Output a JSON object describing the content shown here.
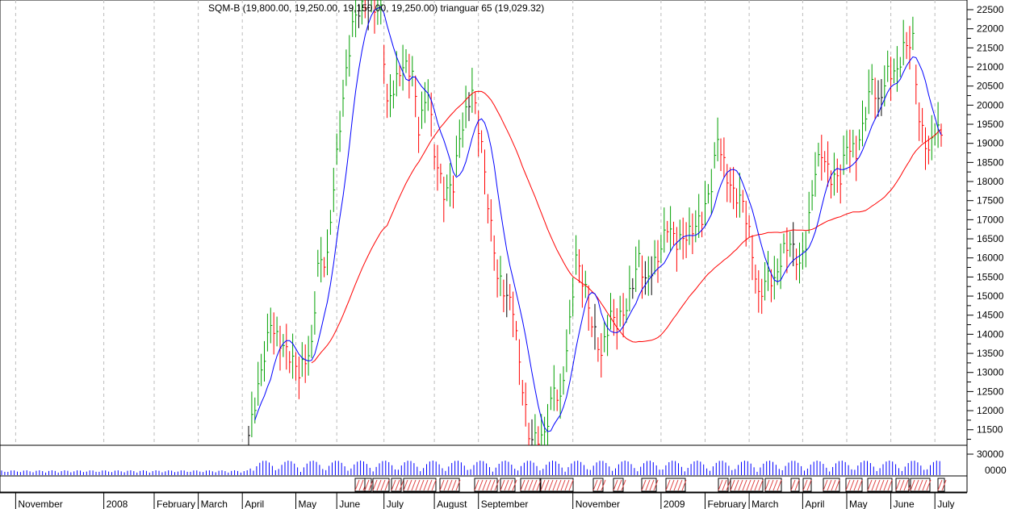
{
  "title": "SQM-B (19,800.00, 19,250.00, 19,150.00, 19,250.00) trianguar 65 (19,029.32)",
  "colors": {
    "up": "#00a000",
    "down": "#ff0000",
    "neutral": "#000000",
    "fast_ma": "#0000ff",
    "slow_ma": "#ff0000",
    "volume": "#0000ff"
  },
  "chart_data": {
    "type": "ohlc",
    "title": "SQM-B",
    "x_unit": "trading day index",
    "ylim": [
      11100,
      22700
    ],
    "y_ticks": [
      11500,
      12000,
      12500,
      13000,
      13500,
      14000,
      14500,
      15000,
      15500,
      16000,
      16500,
      17000,
      17500,
      18000,
      18500,
      19000,
      19500,
      20000,
      20500,
      21000,
      21500,
      22000,
      22500
    ],
    "volume_ticks": [
      "30000",
      "0000"
    ],
    "months": [
      {
        "label": "November",
        "day": -74
      },
      {
        "label": "2008",
        "day": -46
      },
      {
        "label": "February",
        "day": -30
      },
      {
        "label": "March",
        "day": -16
      },
      {
        "label": "April",
        "day": -2
      },
      {
        "label": "May",
        "day": 15
      },
      {
        "label": "June",
        "day": 28
      },
      {
        "label": "July",
        "day": 43
      },
      {
        "label": "August",
        "day": 59
      },
      {
        "label": "September",
        "day": 73
      },
      {
        "label": "November",
        "day": 103
      },
      {
        "label": "2009",
        "day": 131
      },
      {
        "label": "February",
        "day": 145
      },
      {
        "label": "March",
        "day": 159
      },
      {
        "label": "April",
        "day": 176
      },
      {
        "label": "May",
        "day": 190
      },
      {
        "label": "June",
        "day": 204
      },
      {
        "label": "July",
        "day": 218
      }
    ],
    "close_path": [
      [
        0,
        11350
      ],
      [
        3,
        12600
      ],
      [
        7,
        14300
      ],
      [
        9,
        13900
      ],
      [
        13,
        13450
      ],
      [
        16,
        13000
      ],
      [
        20,
        13650
      ],
      [
        22,
        15800
      ],
      [
        25,
        16000
      ],
      [
        27,
        17900
      ],
      [
        30,
        20200
      ],
      [
        33,
        22100
      ],
      [
        35,
        22500
      ],
      [
        38,
        22650
      ],
      [
        42,
        22500
      ],
      [
        44,
        20000
      ],
      [
        47,
        20650
      ],
      [
        49,
        21050
      ],
      [
        52,
        20850
      ],
      [
        54,
        19400
      ],
      [
        57,
        20400
      ],
      [
        59,
        18750
      ],
      [
        62,
        17700
      ],
      [
        65,
        17900
      ],
      [
        67,
        19150
      ],
      [
        71,
        20400
      ],
      [
        74,
        18950
      ],
      [
        76,
        17450
      ],
      [
        79,
        15550
      ],
      [
        81,
        15150
      ],
      [
        84,
        14700
      ],
      [
        86,
        13250
      ],
      [
        89,
        11350
      ],
      [
        91,
        11250
      ],
      [
        94,
        11350
      ],
      [
        97,
        12600
      ],
      [
        99,
        12200
      ],
      [
        102,
        14300
      ],
      [
        104,
        16000
      ],
      [
        107,
        15150
      ],
      [
        109,
        14300
      ],
      [
        112,
        13450
      ],
      [
        115,
        14500
      ],
      [
        117,
        14300
      ],
      [
        120,
        14700
      ],
      [
        124,
        16000
      ],
      [
        126,
        15350
      ],
      [
        130,
        16000
      ],
      [
        133,
        16850
      ],
      [
        136,
        16400
      ],
      [
        140,
        16650
      ],
      [
        144,
        17050
      ],
      [
        147,
        17900
      ],
      [
        149,
        19150
      ],
      [
        152,
        18100
      ],
      [
        154,
        17700
      ],
      [
        157,
        17450
      ],
      [
        159,
        16650
      ],
      [
        162,
        14950
      ],
      [
        165,
        15550
      ],
      [
        167,
        15350
      ],
      [
        170,
        16200
      ],
      [
        172,
        16400
      ],
      [
        175,
        15800
      ],
      [
        177,
        16400
      ],
      [
        180,
        18300
      ],
      [
        182,
        18750
      ],
      [
        185,
        18100
      ],
      [
        188,
        18100
      ],
      [
        190,
        18950
      ],
      [
        193,
        18750
      ],
      [
        195,
        19400
      ],
      [
        198,
        20650
      ],
      [
        200,
        20000
      ],
      [
        203,
        20850
      ],
      [
        206,
        20850
      ],
      [
        208,
        21500
      ],
      [
        211,
        21700
      ],
      [
        213,
        19600
      ],
      [
        216,
        18750
      ],
      [
        218,
        19400
      ],
      [
        220,
        19250
      ]
    ],
    "fast_ma_period": 8,
    "slow_ma_label": "trianguar 65",
    "slow_ma_last": 19029.32
  }
}
